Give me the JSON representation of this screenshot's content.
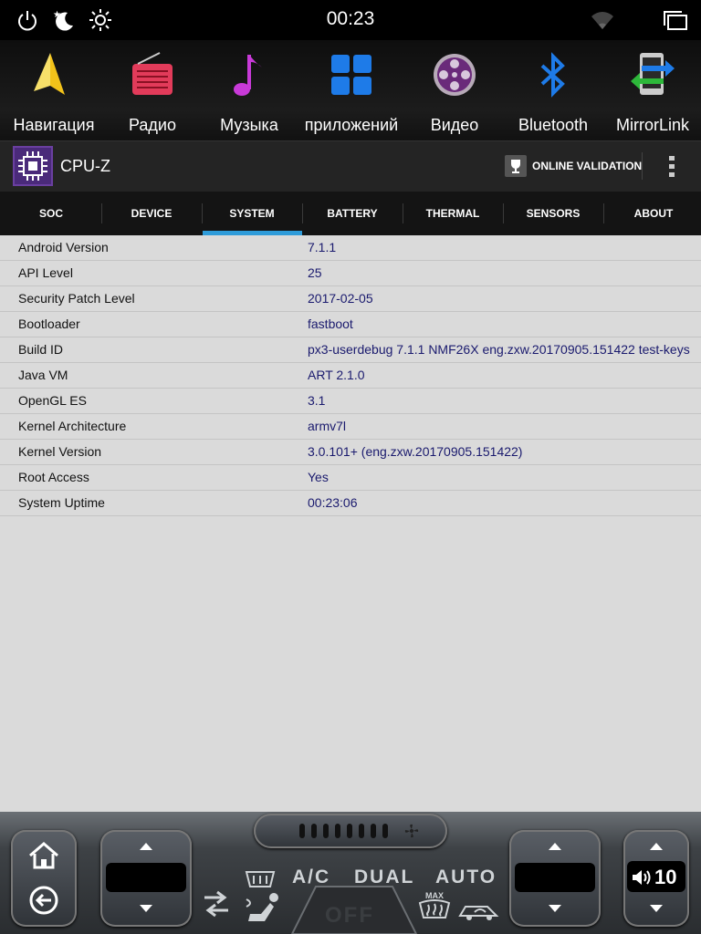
{
  "status_bar": {
    "time": "00:23",
    "icons": [
      "power-icon",
      "night-mode-icon",
      "brightness-icon",
      "wifi-icon",
      "recent-apps-icon"
    ]
  },
  "launcher": {
    "apps": [
      {
        "label": "Навигация",
        "icon": "navigation-icon"
      },
      {
        "label": "Радио",
        "icon": "radio-icon"
      },
      {
        "label": "Музыка",
        "icon": "music-icon"
      },
      {
        "label": "приложений",
        "icon": "apps-grid-icon"
      },
      {
        "label": "Видео",
        "icon": "video-reel-icon"
      },
      {
        "label": "Bluetooth",
        "icon": "bluetooth-icon"
      },
      {
        "label": "MirrorLink",
        "icon": "mirrorlink-icon"
      }
    ]
  },
  "app_bar": {
    "title": "CPU-Z",
    "validation_label": "ONLINE VALIDATION",
    "validation_icon": "trophy-icon",
    "menu_icon": "overflow-menu-icon"
  },
  "tabs": {
    "items": [
      "SOC",
      "DEVICE",
      "SYSTEM",
      "BATTERY",
      "THERMAL",
      "SENSORS",
      "ABOUT"
    ],
    "active": "SYSTEM",
    "accent": "#2e9bd9"
  },
  "system_info": [
    {
      "label": "Android Version",
      "value": "7.1.1"
    },
    {
      "label": "API Level",
      "value": "25"
    },
    {
      "label": "Security Patch Level",
      "value": "2017-02-05"
    },
    {
      "label": "Bootloader",
      "value": "fastboot"
    },
    {
      "label": "Build ID",
      "value": "px3-userdebug 7.1.1 NMF26X eng.zxw.20170905.151422 test-keys"
    },
    {
      "label": "Java VM",
      "value": "ART 2.1.0"
    },
    {
      "label": "OpenGL ES",
      "value": "3.1"
    },
    {
      "label": "Kernel Architecture",
      "value": "armv7l"
    },
    {
      "label": "Kernel Version",
      "value": "3.0.101+ (eng.zxw.20170905.151422)"
    },
    {
      "label": "Root Access",
      "value": "Yes"
    },
    {
      "label": "System Uptime",
      "value": "00:23:06"
    }
  ],
  "climate": {
    "ac_label": "A/C",
    "dual_label": "DUAL",
    "auto_label": "AUTO",
    "off_label": "OFF",
    "volume": "10",
    "icons": [
      "home-icon",
      "back-icon",
      "defrost-rear-icon",
      "defrost-front-max-icon",
      "recirculation-icon",
      "seat-airflow-icon",
      "fan-icon",
      "speaker-icon"
    ]
  }
}
